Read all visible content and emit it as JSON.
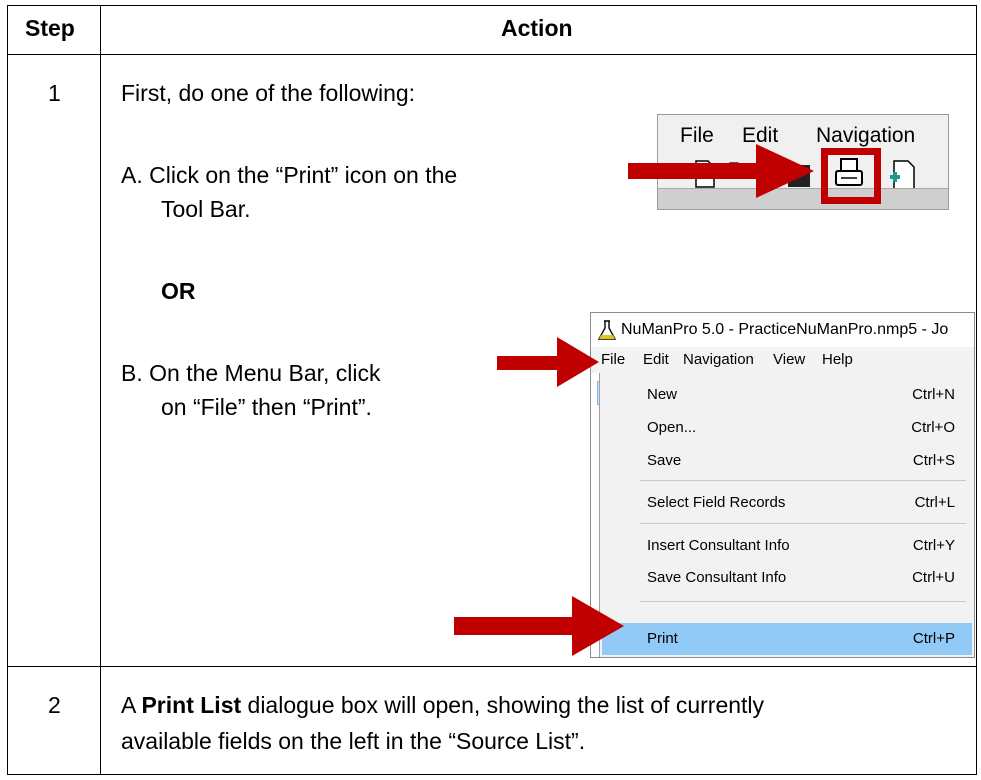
{
  "header": {
    "step": "Step",
    "action": "Action"
  },
  "rows": [
    {
      "step": "1",
      "intro": "First, do one of the following:",
      "option_a_line1": "A.  Click on the “Print” icon on the",
      "option_a_line2": "Tool Bar.",
      "or": "OR",
      "option_b_line1": "B.  On the Menu Bar, click",
      "option_b_line2": "on “File” then “Print”."
    },
    {
      "step": "2",
      "line1_pre": "A ",
      "line1_bold": "Print List",
      "line1_post": " dialogue box will open, showing the list of currently",
      "line2": "available fields on the left in the “Source List”."
    }
  ],
  "toolbar_shot": {
    "menu": [
      "File",
      "Edit",
      "Navigation"
    ],
    "icons": [
      "new-document-icon",
      "open-folder-icon",
      "save-disk-icon",
      "printer-icon",
      "new-record-icon"
    ],
    "highlight_color": "#c00000"
  },
  "menu_shot": {
    "title": "NuManPro 5.0 - PracticeNuManPro.nmp5 - Jo",
    "menubar": [
      "File",
      "Edit",
      "Navigation",
      "View",
      "Help"
    ],
    "items": [
      {
        "label": "New",
        "shortcut": "Ctrl+N"
      },
      {
        "label": "Open...",
        "shortcut": "Ctrl+O"
      },
      {
        "label": "Save",
        "shortcut": "Ctrl+S"
      },
      {
        "label": "Select Field Records",
        "shortcut": "Ctrl+L"
      },
      {
        "label": "Insert Consultant Info",
        "shortcut": "Ctrl+Y"
      },
      {
        "label": "Save Consultant Info",
        "shortcut": "Ctrl+U"
      },
      {
        "label": "Print",
        "shortcut": "Ctrl+P"
      }
    ],
    "highlight_color": "#91c9f7"
  },
  "arrow_color": "#c00000"
}
